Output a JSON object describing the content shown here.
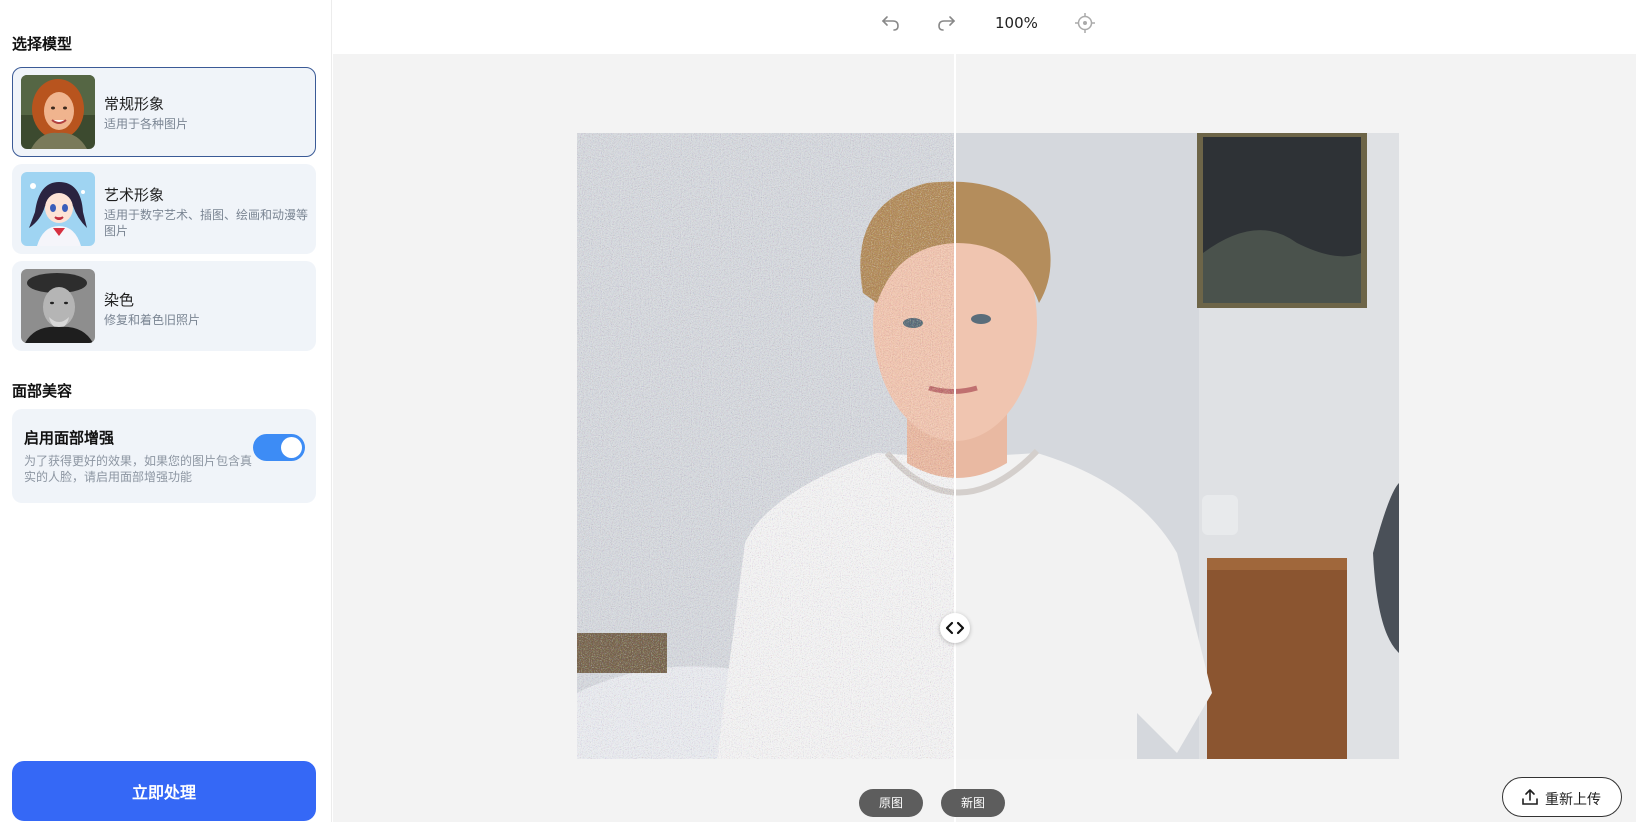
{
  "sidebar": {
    "model_section_title": "选择模型",
    "models": [
      {
        "name": "常规形象",
        "desc": "适用于各种图片",
        "thumb_icon": "red-haired-woman-portrait"
      },
      {
        "name": "艺术形象",
        "desc": "适用于数字艺术、插图、绘画和动漫等图片",
        "thumb_icon": "anime-girl-illustration"
      },
      {
        "name": "染色",
        "desc": "修复和着色旧照片",
        "thumb_icon": "old-man-bw-portrait"
      }
    ],
    "face_section_title": "面部美容",
    "face_enhance": {
      "title": "启用面部增强",
      "desc": "为了获得更好的效果，如果您的图片包含真实的人脸，请启用面部增强功能",
      "enabled": true
    },
    "process_button": "立即处理"
  },
  "toolbar": {
    "undo_icon": "undo-icon",
    "redo_icon": "redo-icon",
    "zoom": "100%",
    "locate_icon": "crosshair-icon"
  },
  "compare": {
    "original_label": "原图",
    "new_label": "新图",
    "handle_icon": "left-right-arrows-icon"
  },
  "reupload_button": "重新上传",
  "colors": {
    "accent": "#3568f6",
    "toggle_on": "#3d8cf5",
    "card_bg": "#f0f4f9"
  }
}
